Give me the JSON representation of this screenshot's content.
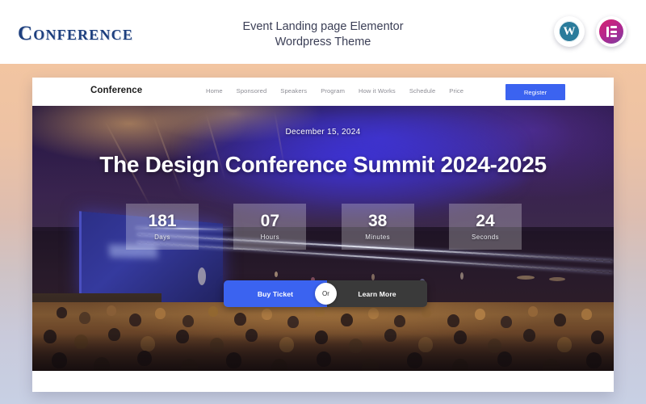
{
  "header": {
    "brand_logo": "Conference",
    "title_line1": "Event Landing page Elementor",
    "title_line2": "Wordpress Theme",
    "badges": [
      {
        "name": "wordpress-badge",
        "glyph": "W",
        "color": "#2a7b9b"
      },
      {
        "name": "elementor-badge",
        "glyph": "E",
        "color": "#c42a7f"
      }
    ]
  },
  "preview": {
    "nav": {
      "logo": "Conference",
      "links": [
        {
          "label": "Home"
        },
        {
          "label": "Sponsored"
        },
        {
          "label": "Speakers"
        },
        {
          "label": "Program"
        },
        {
          "label": "How it Works"
        },
        {
          "label": "Schedule"
        },
        {
          "label": "Price"
        }
      ],
      "register_label": "Register",
      "register_color": "#3b63f0"
    },
    "hero": {
      "date": "December 15, 2024",
      "title": "The Design Conference Summit 2024-2025",
      "countdown": [
        {
          "value": "181",
          "label": "Days"
        },
        {
          "value": "07",
          "label": "Hours"
        },
        {
          "value": "38",
          "label": "Minutes"
        },
        {
          "value": "24",
          "label": "Seconds"
        }
      ],
      "cta_primary": "Buy Ticket",
      "cta_divider": "Or",
      "cta_secondary": "Learn More",
      "cta_primary_color": "#3b63f0",
      "cta_secondary_color": "#3a3a3a"
    }
  },
  "theme": {
    "page_bg_top": "#f2c5a1",
    "page_bg_bottom": "#c8d0e4",
    "logo_color": "#1d3f7e"
  }
}
